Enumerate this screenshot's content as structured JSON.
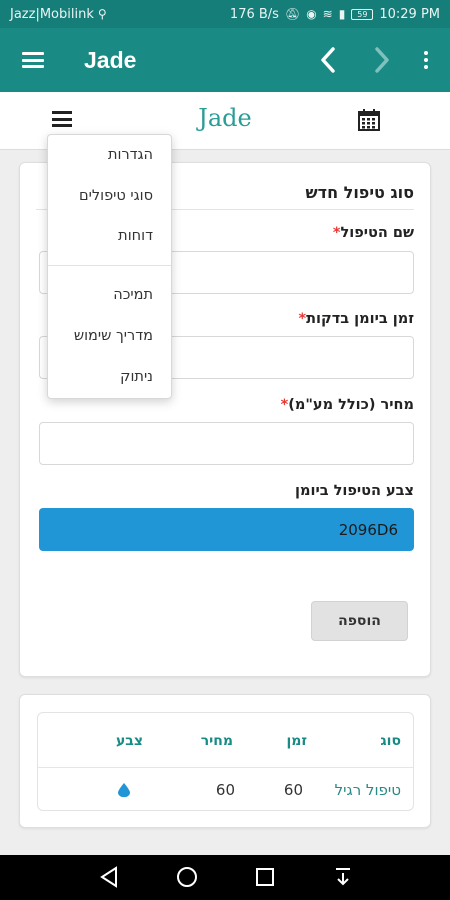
{
  "status_bar": {
    "carrier": "Jazz|Mobilink",
    "speed": "176 B/s",
    "battery": "59",
    "time": "10:29 PM"
  },
  "app_bar": {
    "title": "Jade"
  },
  "header": {
    "brand": "Jade"
  },
  "dropdown_menu": {
    "items": [
      "הגדרות",
      "סוגי טיפולים",
      "דוחות",
      "תמיכה",
      "מדריך שימוש",
      "ניתוק"
    ]
  },
  "form": {
    "title": "סוג טיפול חדש",
    "name_label": "שם הטיפול",
    "duration_label": "זמן ביומן בדקות",
    "price_label": "מחיר (כולל מע\"מ)",
    "color_label": "צבע הטיפול ביומן",
    "color_value": "2096D6",
    "required_mark": "*",
    "add_button": "הוספה"
  },
  "table": {
    "headers": [
      "סוג",
      "זמן",
      "מחיר",
      "צבע"
    ],
    "rows": [
      {
        "type": "טיפול רגיל",
        "time": "60",
        "price": "60",
        "color": "#2196d6"
      }
    ]
  },
  "colors": {
    "primary": "#1a8a84",
    "statusbar": "#167e79",
    "accent_blue": "#2196d6",
    "required": "#e53935"
  }
}
